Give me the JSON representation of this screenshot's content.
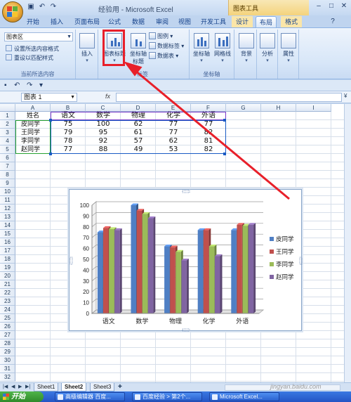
{
  "window": {
    "title": "经验用 - Microsoft Excel",
    "context_tools_label": "图表工具",
    "minimize": "–",
    "maximize": "□",
    "close": "✕"
  },
  "tabs": [
    "开始",
    "插入",
    "页面布局",
    "公式",
    "数据",
    "审阅",
    "视图",
    "开发工具",
    "设计",
    "布局",
    "格式"
  ],
  "active_tab": "布局",
  "ribbon": {
    "current_selection": {
      "combo_value": "图表区",
      "format_selection": "设置所选内容格式",
      "reset_to_match_style": "重设以匹配样式",
      "group_label": "当前所选内容"
    },
    "insert": {
      "label": "插入"
    },
    "labels": {
      "chart_title": "图表标题",
      "axis_titles": "坐标轴标题",
      "legend": "图例",
      "data_labels": "数据标签",
      "data_table": "数据表",
      "group_label": "标签"
    },
    "axes": {
      "axes_label": "坐标轴",
      "gridlines_label": "网格线",
      "group_label": "坐标轴"
    },
    "background": {
      "label": "背景"
    },
    "analysis": {
      "label": "分析"
    },
    "properties": {
      "label": "属性"
    }
  },
  "formula_bar": {
    "name_box": "图表 1",
    "fx": "fx",
    "value": ""
  },
  "grid": {
    "columns": [
      "A",
      "B",
      "C",
      "D",
      "E",
      "F",
      "G",
      "H",
      "I"
    ],
    "rows": [
      "1",
      "2",
      "3",
      "4",
      "5",
      "6",
      "7",
      "8",
      "9",
      "10",
      "11",
      "12",
      "13",
      "14",
      "15",
      "16",
      "17",
      "18",
      "19",
      "20",
      "21",
      "22",
      "23",
      "24",
      "25",
      "26",
      "27",
      "28",
      "29",
      "30",
      "31",
      "32"
    ],
    "header_row": [
      "姓名",
      "语文",
      "数学",
      "物理",
      "化学",
      "外语"
    ],
    "data_rows": [
      [
        "皮同学",
        "75",
        "100",
        "62",
        "77",
        "77"
      ],
      [
        "王同学",
        "79",
        "95",
        "61",
        "77",
        "82"
      ],
      [
        "李同学",
        "78",
        "92",
        "57",
        "62",
        "81"
      ],
      [
        "赵同学",
        "77",
        "88",
        "49",
        "53",
        "82"
      ]
    ]
  },
  "chart_data": {
    "type": "bar",
    "title": "",
    "xlabel": "",
    "ylabel": "",
    "categories": [
      "语文",
      "数学",
      "物理",
      "化学",
      "外语"
    ],
    "series": [
      {
        "name": "皮同学",
        "values": [
          75,
          100,
          62,
          77,
          77
        ],
        "color": "#4f7fc4"
      },
      {
        "name": "王同学",
        "values": [
          79,
          95,
          61,
          77,
          82
        ],
        "color": "#c0504d"
      },
      {
        "name": "李同学",
        "values": [
          78,
          92,
          57,
          62,
          81
        ],
        "color": "#9bbb59"
      },
      {
        "name": "赵同学",
        "values": [
          77,
          88,
          49,
          53,
          82
        ],
        "color": "#8064a2"
      }
    ],
    "ylim": [
      0,
      100
    ],
    "yticks": [
      0,
      10,
      20,
      30,
      40,
      50,
      60,
      70,
      80,
      90,
      100
    ],
    "grid": true,
    "legend": "right",
    "style": "3d-clustered-column"
  },
  "sheets": [
    "Sheet1",
    "Sheet2",
    "Sheet3"
  ],
  "active_sheet": "Sheet2",
  "taskbar": {
    "start": "开始",
    "items": [
      "高级编辑器 百度...",
      "百度经验 > 第2个...",
      "Microsoft Excel..."
    ]
  },
  "watermark": "jingyan.baidu.com",
  "colors": {
    "annotation_red": "#e8202a",
    "ribbon_blue": "#d7e6f8",
    "context_tab": "#f4d37c"
  }
}
